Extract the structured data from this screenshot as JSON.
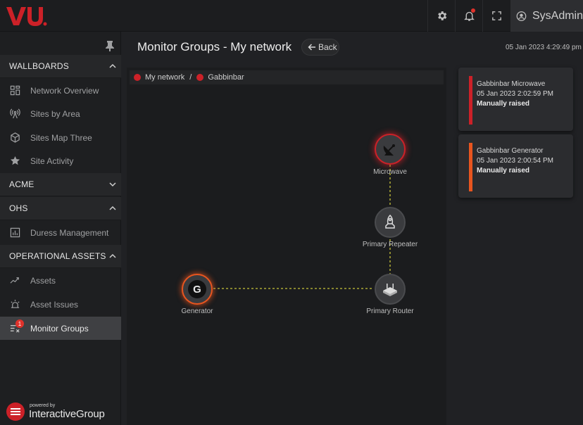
{
  "app": {
    "logo_text": "VU"
  },
  "header": {
    "user_name": "SysAdmin",
    "has_notification": true
  },
  "sidebar": {
    "sections": [
      {
        "title": "WALLBOARDS",
        "expanded": true,
        "items": [
          {
            "label": "Network Overview",
            "icon": "grid-icon"
          },
          {
            "label": "Sites by Area",
            "icon": "antenna-icon"
          },
          {
            "label": "Sites Map Three",
            "icon": "cube-icon"
          },
          {
            "label": "Site Activity",
            "icon": "star-icon"
          }
        ]
      },
      {
        "title": "ACME",
        "expanded": false,
        "items": []
      },
      {
        "title": "OHS",
        "expanded": true,
        "items": [
          {
            "label": "Duress Management",
            "icon": "bar-chart-icon"
          }
        ]
      },
      {
        "title": "OPERATIONAL ASSETS",
        "expanded": true,
        "items": [
          {
            "label": "Assets",
            "icon": "assets-icon"
          },
          {
            "label": "Asset Issues",
            "icon": "alarm-icon"
          },
          {
            "label": "Monitor Groups",
            "icon": "monitor-groups-icon",
            "active": true,
            "badge": "1"
          }
        ]
      }
    ],
    "powered_small": "powered by",
    "powered_big": "InteractiveGroup"
  },
  "main": {
    "title": "Monitor Groups - My network",
    "back_label": "Back",
    "datetime": "05 Jan 2023 4:29:49 pm",
    "breadcrumb": [
      "My network",
      "Gabbinbar"
    ]
  },
  "graph": {
    "nodes": [
      {
        "id": "microwave",
        "label": "Microwave",
        "status": "critical",
        "icon": "satellite-dish-icon"
      },
      {
        "id": "repeater",
        "label": "Primary Repeater",
        "status": "ok",
        "icon": "rocket-icon"
      },
      {
        "id": "router",
        "label": "Primary Router",
        "status": "ok",
        "icon": "router-icon"
      },
      {
        "id": "generator",
        "label": "Generator",
        "status": "warning",
        "icon": "generator-icon",
        "glyph": "G"
      }
    ]
  },
  "alerts": [
    {
      "title": "Gabbinbar Microwave",
      "time": "05 Jan 2023 2:02:59 PM",
      "status": "Manually raised",
      "color": "#cc2128"
    },
    {
      "title": "Gabbinbar Generator",
      "time": "05 Jan 2023 2:00:54 PM",
      "status": "Manually raised",
      "color": "#e8551f"
    }
  ],
  "colors": {
    "accent_red": "#cc2128",
    "accent_orange": "#e8551f",
    "link_line": "#c8c43a"
  }
}
